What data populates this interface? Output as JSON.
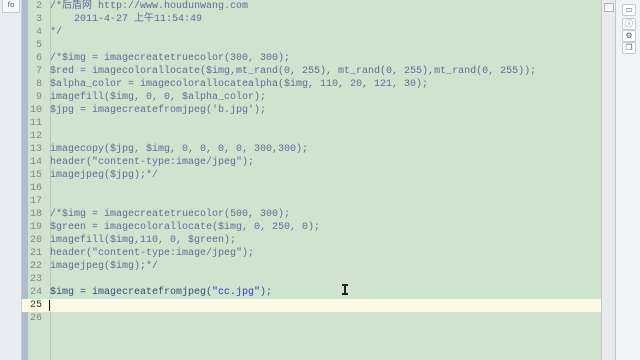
{
  "left_tab": {
    "label": "fo"
  },
  "editor": {
    "current_line": 25,
    "lines": [
      {
        "n": "2",
        "text": "/*后盾网 http://www.houdunwang.com",
        "comment": true
      },
      {
        "n": "3",
        "text": "    2011-4-27 上午11:54:49",
        "comment": true
      },
      {
        "n": "4",
        "text": "*/",
        "comment": true
      },
      {
        "n": "5",
        "text": ""
      },
      {
        "n": "6",
        "text": "/*$img = imagecreatetruecolor(300, 300);",
        "comment": true
      },
      {
        "n": "7",
        "text": "$red = imagecolorallocate($img,mt_rand(0, 255), mt_rand(0, 255),mt_rand(0, 255));",
        "comment": true
      },
      {
        "n": "8",
        "text": "$alpha_color = imagecolorallocatealpha($img, 110, 20, 121, 30);",
        "comment": true
      },
      {
        "n": "9",
        "text": "imagefill($img, 0, 0, $alpha_color);",
        "comment": true
      },
      {
        "n": "10",
        "text": "$jpg = imagecreatefromjpeg('b.jpg');",
        "comment": true
      },
      {
        "n": "11",
        "text": ""
      },
      {
        "n": "12",
        "text": ""
      },
      {
        "n": "13",
        "text": "imagecopy($jpg, $img, 0, 0, 0, 0, 300,300);",
        "comment": true
      },
      {
        "n": "14",
        "text": "header(\"content-type:image/jpeg\");",
        "comment": true
      },
      {
        "n": "15",
        "text": "imagejpeg($jpg);*/",
        "comment": true
      },
      {
        "n": "16",
        "text": ""
      },
      {
        "n": "17",
        "text": ""
      },
      {
        "n": "18",
        "text": "/*$img = imagecreatetruecolor(500, 300);",
        "comment": true
      },
      {
        "n": "19",
        "text": "$green = imagecolorallocate($img, 0, 250, 0);",
        "comment": true
      },
      {
        "n": "20",
        "text": "imagefill($img,110, 0, $green);",
        "comment": true
      },
      {
        "n": "21",
        "text": "header(\"content-type:image/jpeg\");",
        "comment": true
      },
      {
        "n": "22",
        "text": "imagejpeg($img);*/",
        "comment": true
      },
      {
        "n": "23",
        "text": ""
      },
      {
        "n": "24",
        "code_pre": "$img = imagecreatefromjpeg(",
        "code_str": "\"cc.jpg\"",
        "code_post": ");"
      },
      {
        "n": "25",
        "text": ""
      },
      {
        "n": "26",
        "text": ""
      }
    ]
  },
  "right_panel": {
    "icons": [
      {
        "name": "layout-icon",
        "glyph": "▭"
      },
      {
        "name": "info-icon",
        "glyph": "ⓘ"
      },
      {
        "name": "plugin-icon",
        "glyph": "⚙"
      },
      {
        "name": "copy-icon",
        "glyph": "❐"
      }
    ]
  },
  "colors": {
    "editor_bg": "#cfe3cf",
    "current_line_bg": "#fbfbe6",
    "comment": "#5b6f96",
    "string": "#1d3fc8"
  }
}
